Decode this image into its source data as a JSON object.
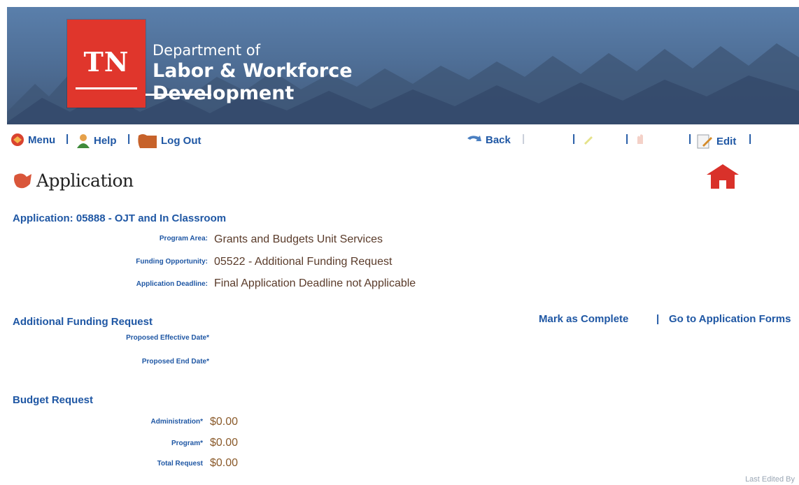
{
  "header": {
    "logo_text": "TN",
    "dept_line1": "Department of",
    "dept_line2": "Labor & Workforce",
    "dept_line3": "Development"
  },
  "toolbar": {
    "menu_label": "Menu",
    "help_label": "Help",
    "logout_label": "Log Out",
    "back_label": "Back",
    "edit_label": "Edit",
    "separator": "|"
  },
  "page": {
    "title": "Application"
  },
  "application": {
    "heading": "Application: 05888 - OJT and In Classroom",
    "fields": [
      {
        "label": "Program Area:",
        "value": "Grants and Budgets Unit Services"
      },
      {
        "label": "Funding Opportunity:",
        "value": "05522 - Additional Funding Request"
      },
      {
        "label": "Application Deadline:",
        "value": "Final Application Deadline not Applicable"
      }
    ]
  },
  "additional_funding": {
    "heading": "Additional Funding Request",
    "mark_complete": "Mark as Complete",
    "separator": "|",
    "go_to_forms": "Go to Application Forms",
    "fields": [
      {
        "label": "Proposed Effective Date*",
        "value": ""
      },
      {
        "label": "Proposed End Date*",
        "value": ""
      }
    ]
  },
  "budget_request": {
    "heading": "Budget Request",
    "fields": [
      {
        "label": "Administration*",
        "value": "$0.00"
      },
      {
        "label": "Program*",
        "value": "$0.00"
      },
      {
        "label": "Total Request",
        "value": "$0.00"
      }
    ]
  },
  "footer": {
    "last_edited": "Last Edited By"
  },
  "colors": {
    "link_blue": "#1f57a4",
    "logo_red": "#e0362c",
    "value_brown": "#5a3b2a",
    "home_icon_red": "#d9312a"
  }
}
